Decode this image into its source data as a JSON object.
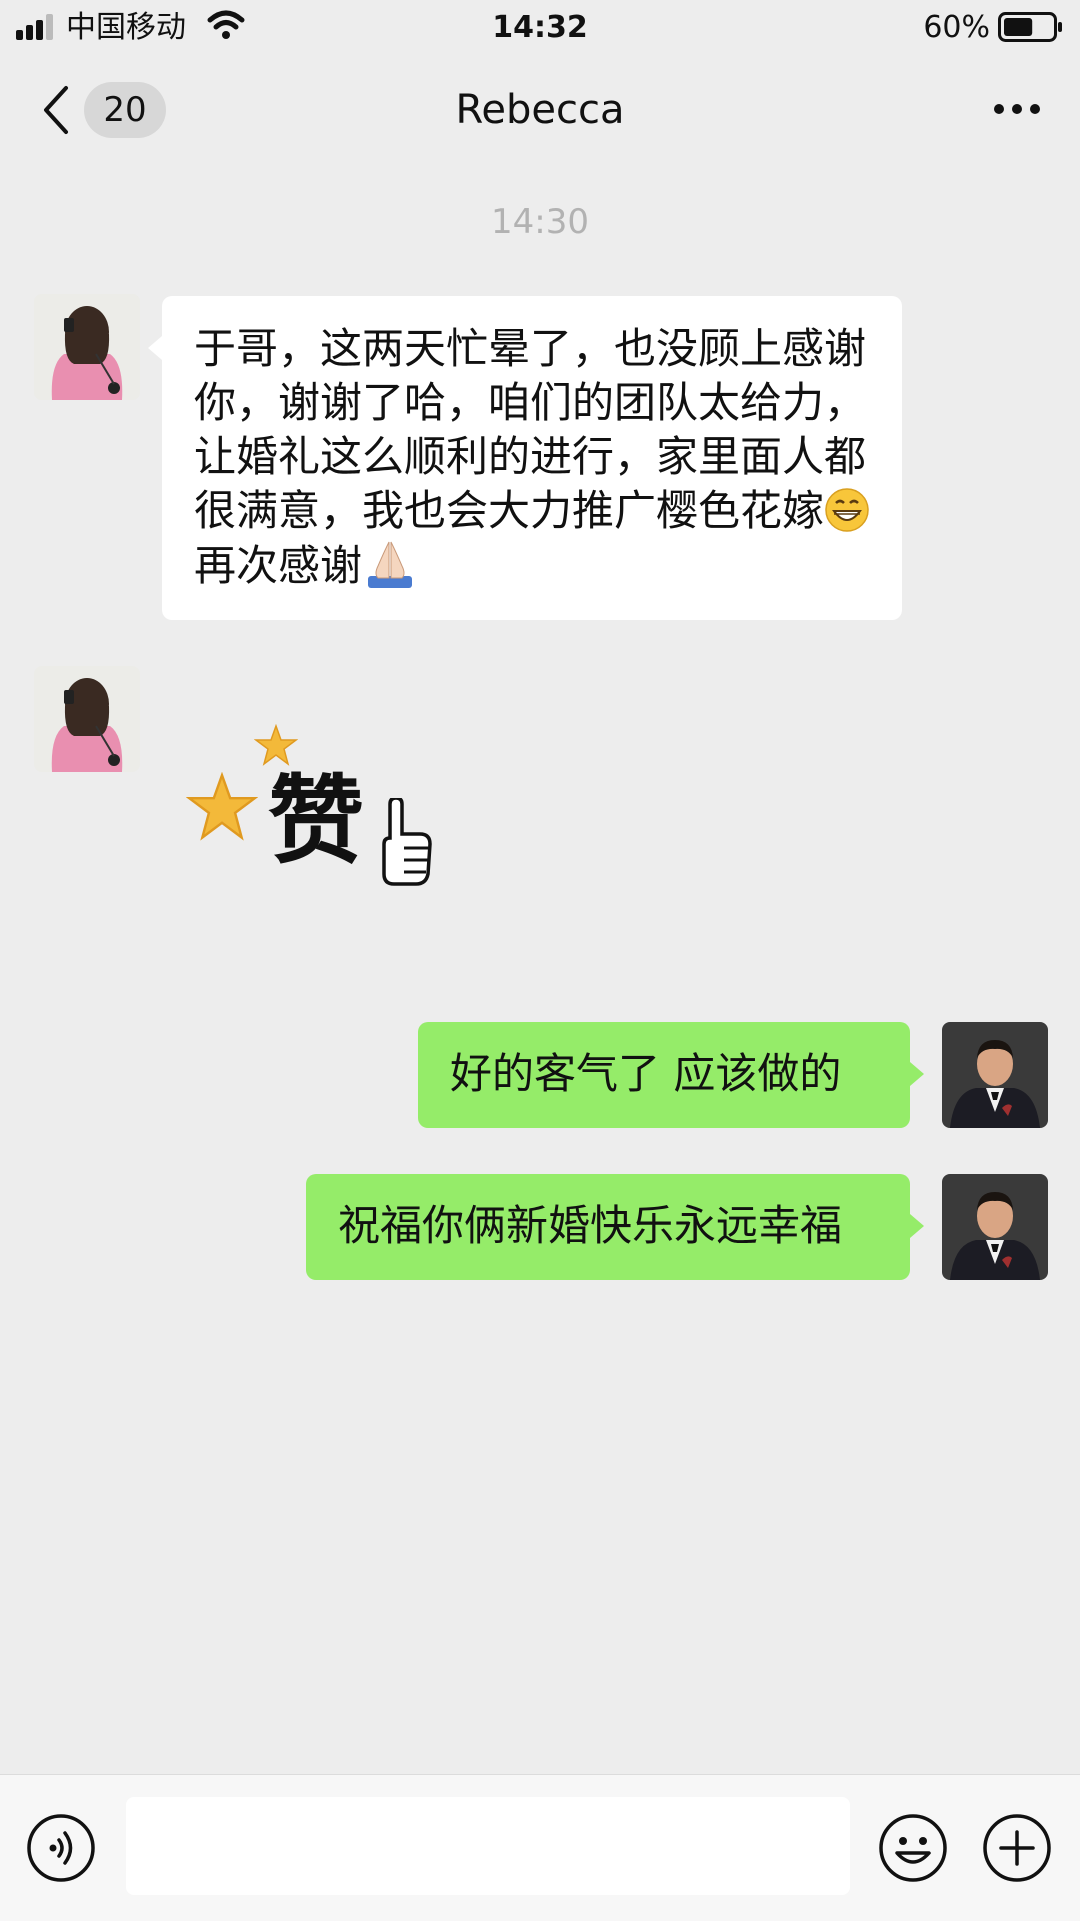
{
  "status_bar": {
    "carrier": "中国移动",
    "time": "14:32",
    "battery_percent": "60%",
    "battery_level": 0.6
  },
  "nav": {
    "unread_count": "20",
    "title": "Rebecca"
  },
  "chat": {
    "timestamp": "14:30",
    "messages": [
      {
        "side": "left",
        "text_part1": "于哥，这两天忙晕了，也没顾上感谢你，谢谢了哈，咱们的团队太给力，让婚礼这么顺利的进行，家里面人都很满意，我也会大力推广樱色花嫁",
        "text_part2": "再次感谢",
        "emojis": [
          "grinning-face-emoji",
          "folded-hands-emoji"
        ]
      },
      {
        "side": "left",
        "sticker_text": "赞",
        "sticker_icons": [
          "star-icon",
          "star-icon",
          "thumbs-up-icon"
        ]
      },
      {
        "side": "right",
        "text": "好的客气了 应该做的"
      },
      {
        "side": "right",
        "text": "祝福你俩新婚快乐永远幸福"
      }
    ]
  },
  "input_bar": {
    "voice_icon": "voice-icon",
    "emoji_icon": "smiley-icon",
    "plus_icon": "plus-icon"
  },
  "colors": {
    "background": "#ededed",
    "my_bubble": "#95ec69",
    "their_bubble": "#ffffff"
  }
}
